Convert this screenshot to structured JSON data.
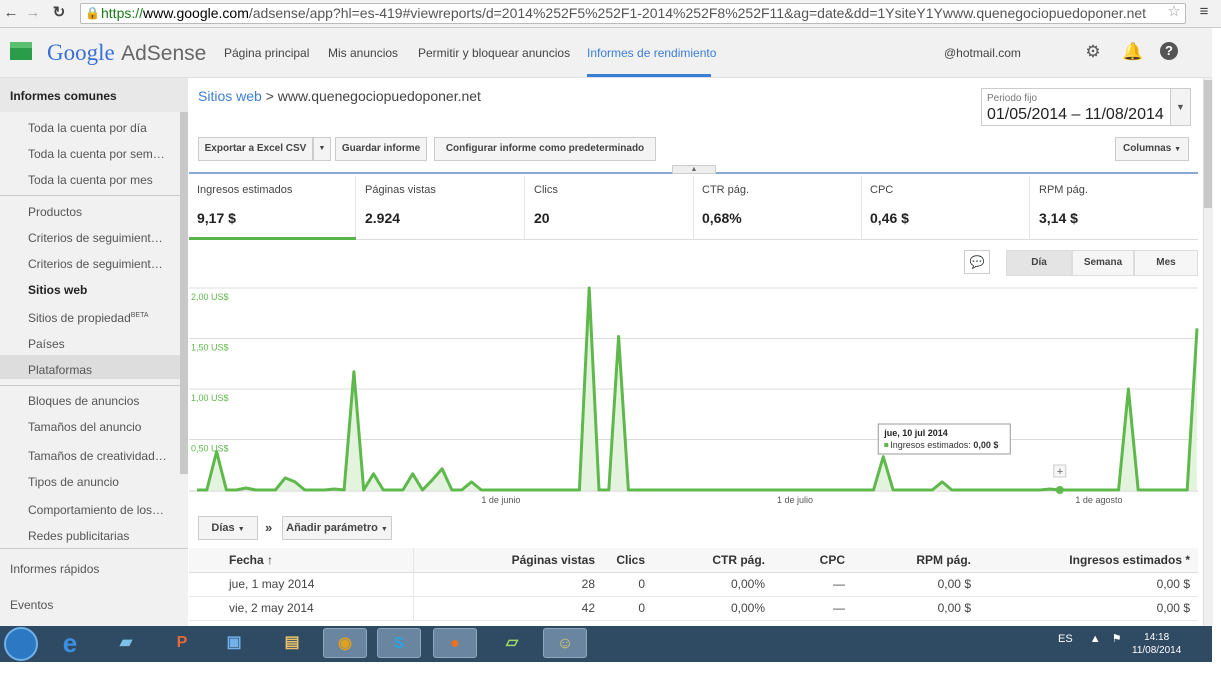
{
  "browser": {
    "url_https": "https://",
    "url_host": "www.google.com",
    "url_rest": "/adsense/app?hl=es-419#viewreports/d=2014%252F5%252F1-2014%252F8%252F11&ag=date&dd=1YsiteY1Ywww.quenegociopuedoponer.net"
  },
  "header": {
    "logo_google": "Google",
    "logo_product": "AdSense",
    "nav": [
      "Página principal",
      "Mis anuncios",
      "Permitir y bloquear anuncios",
      "Informes de rendimiento"
    ],
    "email": "@hotmail.com"
  },
  "sidebar": {
    "heading": "Informes comunes",
    "items": [
      "Toda la cuenta por día",
      "Toda la cuenta por sem…",
      "Toda la cuenta por mes",
      "Productos",
      "Criterios de seguimient…",
      "Criterios de seguimient…",
      "Sitios web",
      "Sitios de propiedad",
      "Países",
      "Plataformas",
      "Bloques de anuncios",
      "Tamaños del anuncio",
      "Tamaños de creatividad…",
      "Tipos de anuncio",
      "Comportamiento de los…",
      "Redes publicitarias"
    ],
    "beta": "BETA",
    "section_quick": "Informes rápidos",
    "section_events": "Eventos"
  },
  "breadcrumb": {
    "root": "Sitios web",
    "sep": ">",
    "site": "www.quenegociopuedoponer.net"
  },
  "period": {
    "label": "Periodo fijo",
    "value": "01/05/2014 – 11/08/2014"
  },
  "toolbar": {
    "export": "Exportar a Excel CSV",
    "save": "Guardar informe",
    "default": "Configurar informe como predeterminado",
    "columns": "Columnas"
  },
  "metrics": [
    {
      "label": "Ingresos estimados",
      "value": "9,17 $"
    },
    {
      "label": "Páginas vistas",
      "value": "2.924"
    },
    {
      "label": "Clics",
      "value": "20"
    },
    {
      "label": "CTR pág.",
      "value": "0,68%"
    },
    {
      "label": "CPC",
      "value": "0,46 $"
    },
    {
      "label": "RPM pág.",
      "value": "3,14 $"
    }
  ],
  "range": {
    "day": "Día",
    "week": "Semana",
    "month": "Mes"
  },
  "chart_data": {
    "type": "area",
    "title": "",
    "series": [
      {
        "name": "Ingresos estimados"
      }
    ],
    "y_tick_labels": [
      "2,00 US$",
      "1,50 US$",
      "1,00 US$",
      "0,50 US$"
    ],
    "ylim": [
      0,
      2.0
    ],
    "x_tick_labels": [
      "1 de junio",
      "1 de julio",
      "1 de agosto"
    ],
    "x": [
      "2014-05-01",
      "2014-05-02",
      "2014-05-03",
      "2014-05-04",
      "2014-05-05",
      "2014-05-06",
      "2014-05-07",
      "2014-05-08",
      "2014-05-09",
      "2014-05-10",
      "2014-05-11",
      "2014-05-12",
      "2014-05-13",
      "2014-05-14",
      "2014-05-15",
      "2014-05-16",
      "2014-05-17",
      "2014-05-18",
      "2014-05-19",
      "2014-05-20",
      "2014-05-21",
      "2014-05-22",
      "2014-05-23",
      "2014-05-24",
      "2014-05-25",
      "2014-05-26",
      "2014-05-27",
      "2014-05-28",
      "2014-05-29",
      "2014-05-30",
      "2014-05-31",
      "2014-06-01",
      "2014-06-02",
      "2014-06-03",
      "2014-06-04",
      "2014-06-05",
      "2014-06-06",
      "2014-06-07",
      "2014-06-08",
      "2014-06-09",
      "2014-06-10",
      "2014-06-11",
      "2014-06-12",
      "2014-06-13",
      "2014-06-14",
      "2014-06-15",
      "2014-06-16",
      "2014-06-17",
      "2014-06-18",
      "2014-06-19",
      "2014-06-20",
      "2014-06-21",
      "2014-06-22",
      "2014-06-23",
      "2014-06-24",
      "2014-06-25",
      "2014-06-26",
      "2014-06-27",
      "2014-06-28",
      "2014-06-29",
      "2014-06-30",
      "2014-07-01",
      "2014-07-02",
      "2014-07-03",
      "2014-07-04",
      "2014-07-05",
      "2014-07-06",
      "2014-07-07",
      "2014-07-08",
      "2014-07-09",
      "2014-07-10",
      "2014-07-11",
      "2014-07-12",
      "2014-07-13",
      "2014-07-14",
      "2014-07-15",
      "2014-07-16",
      "2014-07-17",
      "2014-07-18",
      "2014-07-19",
      "2014-07-20",
      "2014-07-21",
      "2014-07-22",
      "2014-07-23",
      "2014-07-24",
      "2014-07-25",
      "2014-07-26",
      "2014-07-27",
      "2014-07-28",
      "2014-07-29",
      "2014-07-30",
      "2014-07-31",
      "2014-08-01",
      "2014-08-02",
      "2014-08-03",
      "2014-08-04",
      "2014-08-05",
      "2014-08-06",
      "2014-08-07",
      "2014-08-08",
      "2014-08-09",
      "2014-08-10",
      "2014-08-11"
    ],
    "values": [
      0,
      0,
      0.38,
      0,
      0,
      0.02,
      0,
      0,
      0,
      0.12,
      0.08,
      0,
      0,
      0,
      0.01,
      0,
      1.17,
      0,
      0.16,
      0,
      0,
      0,
      0.16,
      0,
      0.1,
      0.21,
      0,
      0,
      0.08,
      0,
      0,
      0,
      0,
      0,
      0,
      0,
      0,
      0,
      0,
      0,
      2.0,
      0,
      0,
      1.52,
      0,
      0,
      0,
      0,
      0,
      0,
      0,
      0,
      0,
      0,
      0,
      0,
      0,
      0,
      0,
      0,
      0,
      0,
      0,
      0,
      0,
      0,
      0,
      0,
      0,
      0,
      0.33,
      0,
      0,
      0,
      0,
      0,
      0.08,
      0,
      0,
      0,
      0,
      0,
      0,
      0,
      0,
      0,
      0,
      0.01,
      0,
      0,
      0,
      0,
      0,
      0,
      0,
      1.0,
      0,
      0,
      0,
      0,
      0,
      0,
      1.6
    ],
    "tooltip": {
      "title": "jue, 10 jul 2014",
      "series": "Ingresos estimados",
      "value": "0,00 $"
    },
    "grid": true
  },
  "params": {
    "group": "Días",
    "add": "Añadir parámetro"
  },
  "table": {
    "headers": [
      "Fecha",
      "Páginas vistas",
      "Clics",
      "CTR pág.",
      "CPC",
      "RPM pág.",
      "Ingresos estimados *"
    ],
    "sort_arrow": "↑",
    "rows": [
      [
        "jue, 1 may 2014",
        "28",
        "0",
        "0,00%",
        "—",
        "0,00 $",
        "0,00 $"
      ],
      [
        "vie, 2 may 2014",
        "42",
        "0",
        "0,00%",
        "—",
        "0,00 $",
        "0,00 $"
      ]
    ]
  },
  "taskbar": {
    "lang": "ES",
    "time": "14:18",
    "date": "11/08/2014"
  }
}
